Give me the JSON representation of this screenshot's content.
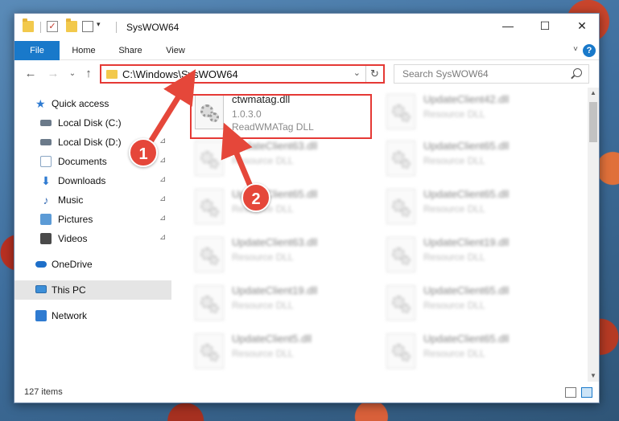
{
  "window": {
    "title": "SysWOW64",
    "controls": {
      "minimize": "—",
      "maximize": "☐",
      "close": "✕"
    }
  },
  "ribbon": {
    "tabs": [
      "File",
      "Home",
      "Share",
      "View"
    ],
    "help": "?",
    "collapse": "˅"
  },
  "address": {
    "path": "C:\\Windows\\SysWOW64",
    "dropdown": "⌄",
    "refresh": "↻"
  },
  "search": {
    "placeholder": "Search SysWOW64"
  },
  "nav": {
    "back": "←",
    "forward": "→",
    "recent": "⌄",
    "up": "↑"
  },
  "sidebar": {
    "items": [
      {
        "label": "Quick access",
        "icon": "star-icon",
        "color": "#2f7bd1"
      },
      {
        "label": "Local Disk (C:)",
        "icon": "drive-icon",
        "color": "#6b7a8a",
        "pinned": true
      },
      {
        "label": "Local Disk (D:)",
        "icon": "drive-icon",
        "color": "#6b7a8a",
        "pinned": true
      },
      {
        "label": "Documents",
        "icon": "documents-icon",
        "color": "#8aa6c4",
        "pinned": true
      },
      {
        "label": "Downloads",
        "icon": "downloads-icon",
        "color": "#2f7bd1",
        "pinned": true
      },
      {
        "label": "Music",
        "icon": "music-icon",
        "color": "#3a6fb5",
        "pinned": true
      },
      {
        "label": "Pictures",
        "icon": "pictures-icon",
        "color": "#5c9bd6",
        "pinned": true
      },
      {
        "label": "Videos",
        "icon": "videos-icon",
        "color": "#4a4a4a",
        "pinned": true
      },
      {
        "label": "OneDrive",
        "icon": "onedrive-icon",
        "color": "#1e6fc9"
      },
      {
        "label": "This PC",
        "icon": "this-pc-icon",
        "color": "#3d8fd8",
        "selected": true
      },
      {
        "label": "Network",
        "icon": "network-icon",
        "color": "#2f7bd1"
      }
    ],
    "pin_glyph": "📌"
  },
  "files": {
    "highlighted": {
      "name": "ctwmatag.dll",
      "version": "1.0.3.0",
      "description": "ReadWMATag DLL"
    },
    "blurred": [
      {
        "name": "UpdateClient42.dll",
        "type": "Resource DLL"
      },
      {
        "name": "UpdateClient63.dll",
        "type": "Resource DLL"
      },
      {
        "name": "UpdateClient65.dll",
        "type": "Resource DLL"
      },
      {
        "name": "UpdateClient65.dll",
        "type": "Resource DLL"
      },
      {
        "name": "UpdateClient65.dll",
        "type": "Resource DLL"
      },
      {
        "name": "UpdateClient63.dll",
        "type": "Resource DLL"
      },
      {
        "name": "UpdateClient19.dll",
        "type": "Resource DLL"
      },
      {
        "name": "UpdateClient19.dll",
        "type": "Resource DLL"
      },
      {
        "name": "UpdateClient65.dll",
        "type": "Resource DLL"
      },
      {
        "name": "UpdateClient5.dll",
        "type": "Resource DLL"
      },
      {
        "name": "UpdateClient65.dll",
        "type": "Resource DLL"
      }
    ]
  },
  "status": {
    "items_count": "127 items"
  },
  "annotations": {
    "badge_1": "1",
    "badge_2": "2",
    "color": "#e5473a"
  }
}
